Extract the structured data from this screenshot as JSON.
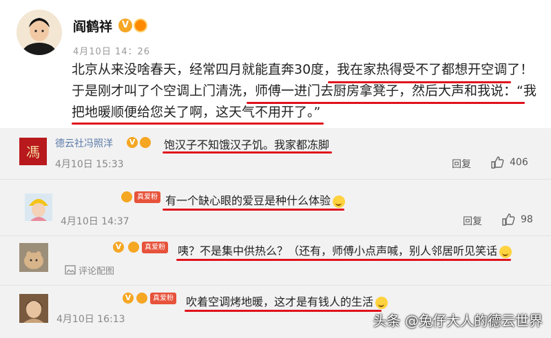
{
  "post": {
    "author": "阎鹤祥",
    "verified_mark": "V",
    "time": "4月10日 14：26",
    "lines": [
      "北京从来没啥春天，经常四月就能直奔30度，我在家热得受不了都想开空调了！",
      "于是刚才叫了个空调上门清洗，师傅一进门去厨房拿凳子，然后大声和我说：“我",
      "把地暖顺便给您关了啊，这天气不用开了。”"
    ]
  },
  "comments": [
    {
      "name": "德云社冯照洋",
      "verified_mark": "V",
      "text": "饱汉子不知饿汉子饥。我家都冻脚",
      "time": "4月10日 15:33",
      "reply": "回复",
      "likes": "406"
    },
    {
      "badge": "真爱粉",
      "text": "有一个缺心眼的爱豆是种什么体验",
      "time": "4月10日 14:37",
      "reply": "回复",
      "likes": "98"
    },
    {
      "badge": "真爱粉",
      "verified_mark": "V",
      "text": "咦？不是集中供热么？（还有，师傅小点声喊，别人邻居听见笑话",
      "link": "评论配图"
    },
    {
      "badge": "真爱粉",
      "verified_mark": "V",
      "text": "吹着空调烤地暖，这才是有钱人的生活",
      "time": "4月10日 16:13"
    }
  ],
  "watermark": "头条 @兔仔大人的德云世界",
  "colors": {
    "underline": "#e0111b",
    "link": "#5a7aa8",
    "comment_bg": "#f2f2f2"
  },
  "icons": [
    "verified-v-icon",
    "vip-icon",
    "thumb-up-icon",
    "image-icon",
    "emoji-icon"
  ]
}
